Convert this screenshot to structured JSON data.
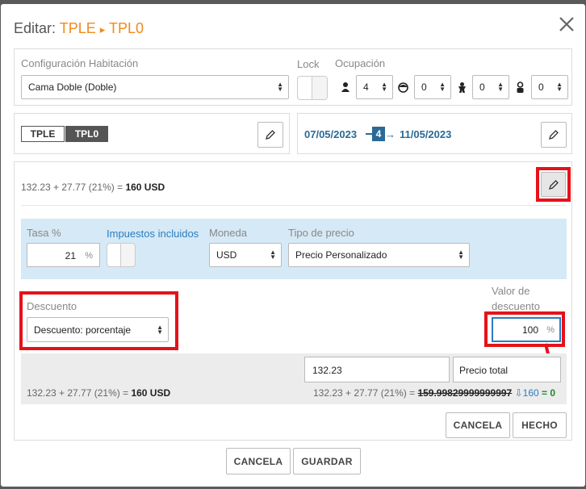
{
  "header": {
    "title_prefix": "Editar:",
    "code_from": "TPLE",
    "arrow": "▸",
    "code_to": "TPL0"
  },
  "room": {
    "config_label": "Configuración Habitación",
    "config_value": "Cama Doble (Doble)",
    "lock_label": "Lock",
    "occupancy_label": "Ocupación",
    "adults": "4",
    "juniors": "0",
    "children": "0",
    "infants": "0"
  },
  "rates": {
    "tag_1": "TPLE",
    "tag_2": "TPL0",
    "date_from": "07/05/2023",
    "nights": "4",
    "date_to": "11/05/2023"
  },
  "price": {
    "formula_main": "132.23 + 27.77 (21%) = ",
    "formula_main_total": "160 USD",
    "tax_label": "Tasa %",
    "tax_value": "21",
    "tax_unit": "%",
    "taxes_included_label": "Impuestos incluidos",
    "currency_label": "Moneda",
    "currency_value": "USD",
    "price_type_label": "Tipo de precio",
    "price_type_value": "Precio Personalizado",
    "discount_label": "Descuento",
    "discount_type_value": "Descuento: porcentaje",
    "discount_value_label": "Valor de descuento",
    "discount_value": "100",
    "discount_unit": "%",
    "base_amount": "132.23",
    "total_type": "Precio total",
    "formula_bottom": "132.23 + 27.77 (21%) = ",
    "formula_bottom_total": "160 USD",
    "formula_right": "132.23 + 27.77 (21%) = ",
    "formula_right_struck": "159.99829999999997",
    "formula_right_new": "160",
    "formula_right_result": "= 0"
  },
  "actions": {
    "inner_cancel": "CANCELA",
    "inner_done": "HECHO",
    "cancel": "CANCELA",
    "save": "GUARDAR"
  }
}
